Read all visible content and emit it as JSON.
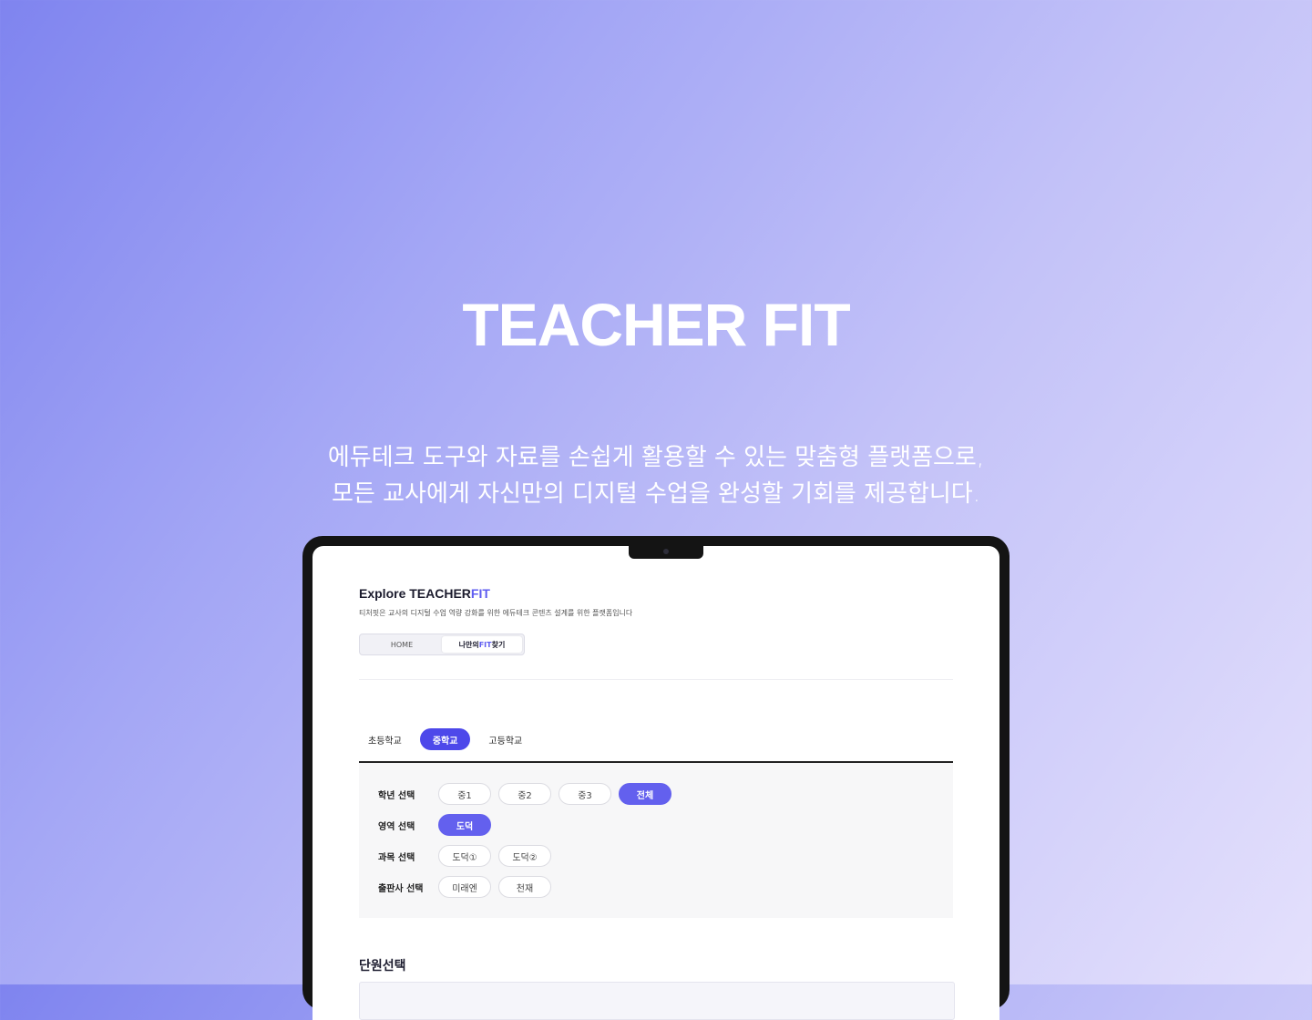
{
  "hero": {
    "title": "TEACHER FIT",
    "subtitle_line1": "에듀테크 도구와 자료를 손쉽게 활용할 수 있는 맞춤형 플랫폼으로,",
    "subtitle_line2": "모든 교사에게 자신만의 디지털 수업을 완성할 기회를 제공합니다."
  },
  "app": {
    "title_main": "Explore TEACHER",
    "title_accent": "FIT",
    "description": "티처핏은 교사의 디지털 수업 역량 강화를 위한 에듀테크 콘텐츠 설계를 위한 플랫폼입니다",
    "nav": {
      "home": "HOME",
      "fit_prefix": "나만의 ",
      "fit_word": "FIT",
      "fit_suffix": " 찾기"
    },
    "school_tabs": [
      "초등학교",
      "중학교",
      "고등학교"
    ],
    "active_school_tab": "중학교",
    "filters": {
      "grade": {
        "label": "학년 선택",
        "options": [
          "중1",
          "중2",
          "중3",
          "전체"
        ],
        "selected": "전체"
      },
      "area": {
        "label": "영역 선택",
        "options": [
          "도덕"
        ],
        "selected": "도덕"
      },
      "subject": {
        "label": "과목 선택",
        "options": [
          "도덕①",
          "도덕②"
        ],
        "selected": null
      },
      "publisher": {
        "label": "출판사 선택",
        "options": [
          "미래엔",
          "천재"
        ],
        "selected": null
      }
    },
    "unit_section_title": "단원선택"
  },
  "colors": {
    "accent": "#5e5cf0",
    "active_chip": "#6360ee",
    "active_tab": "#4d48ea"
  }
}
